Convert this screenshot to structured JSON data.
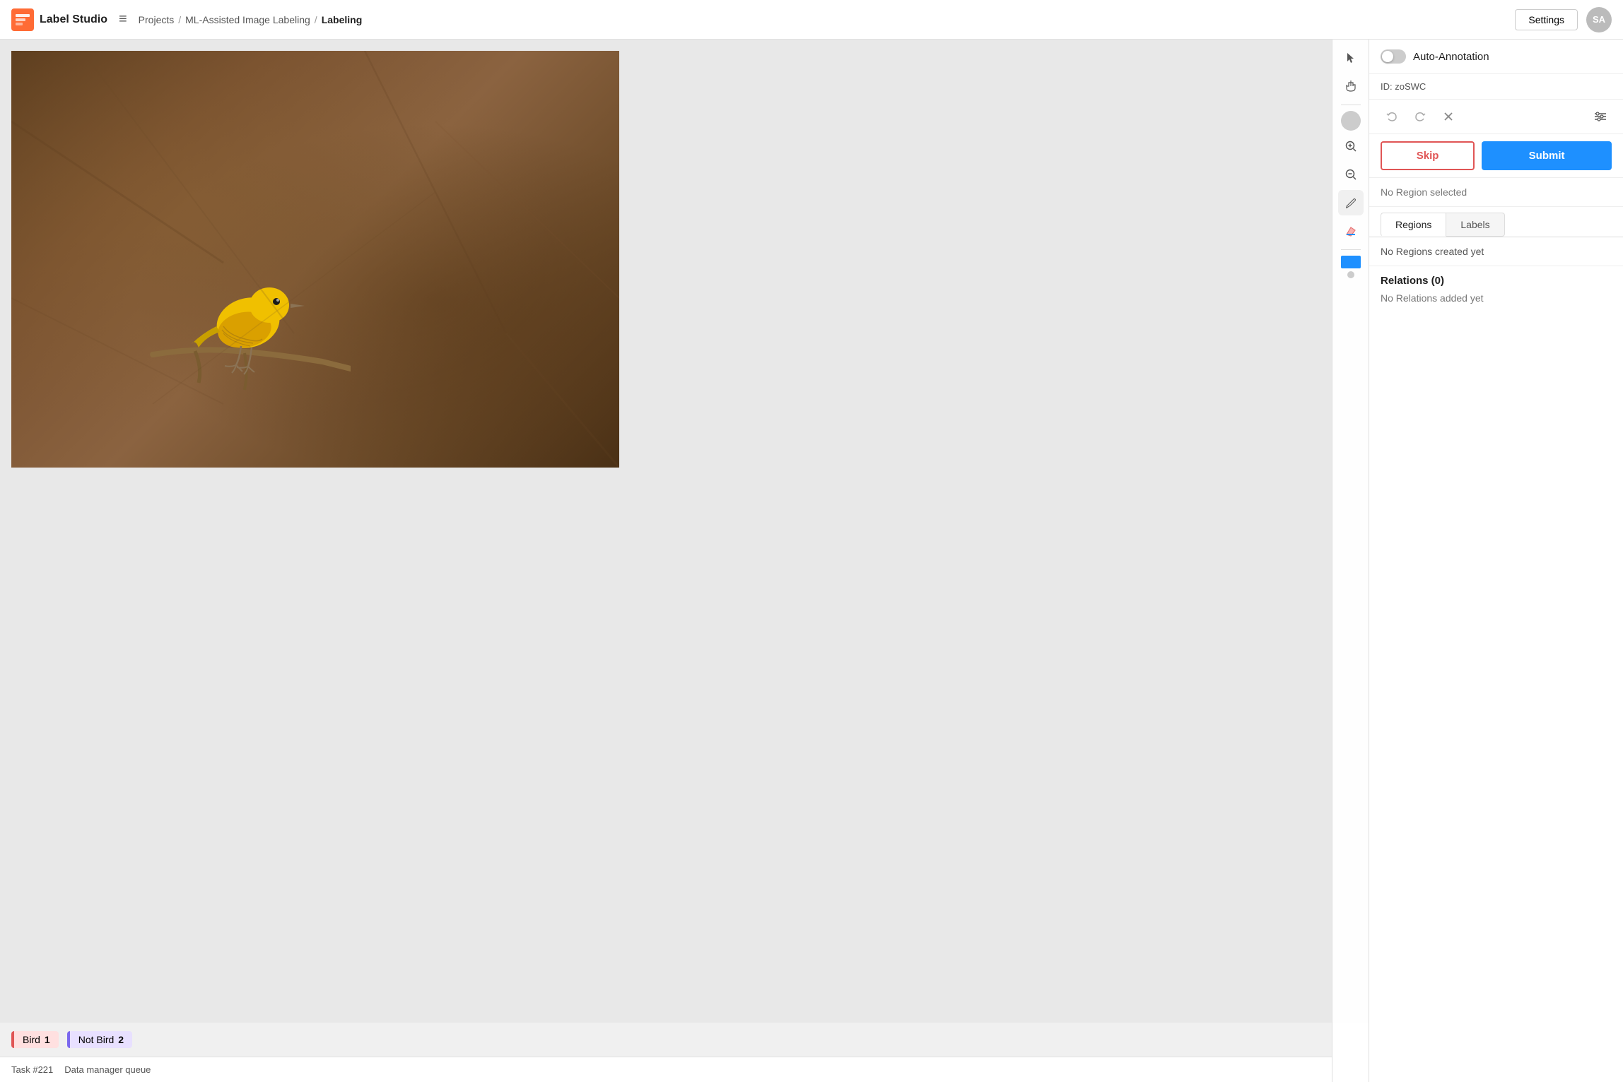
{
  "app": {
    "title": "Label Studio",
    "logo_text": "Label Studio"
  },
  "header": {
    "menu_icon": "≡",
    "breadcrumb": {
      "projects": "Projects",
      "sep1": "/",
      "project_name": "ML-Assisted Image Labeling",
      "sep2": "/",
      "current": "Labeling"
    },
    "settings_label": "Settings",
    "avatar_initials": "SA"
  },
  "toolbar": {
    "tools": [
      {
        "name": "select",
        "icon": "▲",
        "title": "Select"
      },
      {
        "name": "pan",
        "icon": "✋",
        "title": "Pan"
      },
      {
        "name": "zoom-in",
        "icon": "⊕",
        "title": "Zoom In"
      },
      {
        "name": "zoom-out",
        "icon": "⊖",
        "title": "Zoom Out"
      },
      {
        "name": "brush",
        "icon": "✏",
        "title": "Brush"
      },
      {
        "name": "eraser",
        "icon": "◈",
        "title": "Eraser"
      }
    ]
  },
  "labels_bar": {
    "labels": [
      {
        "name": "Bird",
        "count": 1,
        "color": "bird"
      },
      {
        "name": "Not Bird",
        "count": 2,
        "color": "notbird"
      }
    ]
  },
  "status_bar": {
    "task_id": "Task #221",
    "queue_info": "Data manager queue"
  },
  "right_panel": {
    "auto_annotation_label": "Auto-Annotation",
    "id_label": "ID: zoSWC",
    "undo_icon": "↩",
    "redo_icon": "↪",
    "close_icon": "✕",
    "settings_icon": "⇌",
    "skip_label": "Skip",
    "submit_label": "Submit",
    "no_region_text": "No Region selected",
    "tabs": [
      {
        "id": "regions",
        "label": "Regions",
        "active": true
      },
      {
        "id": "labels",
        "label": "Labels",
        "active": false
      }
    ],
    "no_regions_text": "No Regions created yet",
    "relations_title": "Relations (0)",
    "no_relations_text": "No Relations added yet"
  }
}
